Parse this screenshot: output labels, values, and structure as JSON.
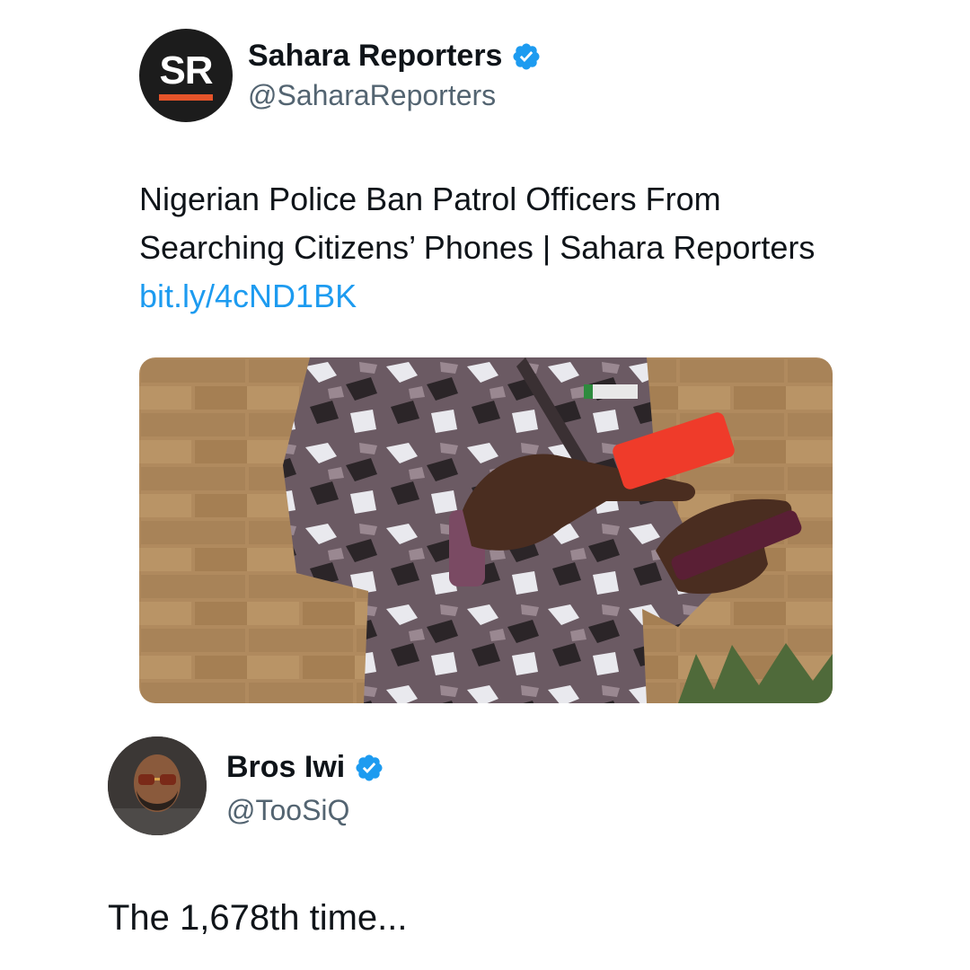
{
  "original_tweet": {
    "avatar_initials": "SR",
    "display_name": "Sahara Reporters",
    "handle": "@SaharaReporters",
    "verified": true,
    "text_before_link": "Nigerian Police Ban Patrol Officers From Searching Citizens’ Phones  | Sahara Reporters ",
    "link_text": "bit.ly/4cND1BK",
    "media_description_icon": "photo-officer-holding-phones"
  },
  "reply_tweet": {
    "display_name": "Bros Iwi",
    "handle": "@TooSiQ",
    "verified": true,
    "text": "The 1,678th time..."
  },
  "colors": {
    "link": "#1d9bf0",
    "verified_badge": "#1d9bf0",
    "handle_gray": "#536471",
    "brand_orange": "#e5542a"
  }
}
